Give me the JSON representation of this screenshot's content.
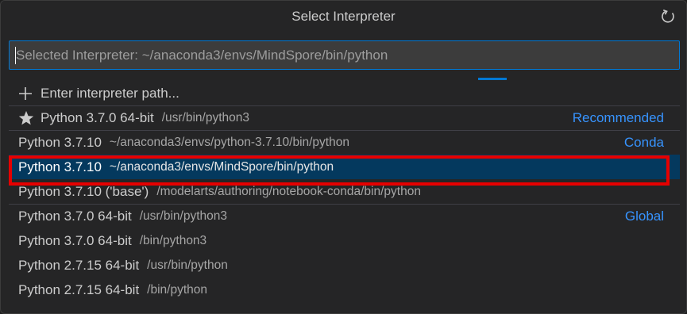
{
  "title": "Select Interpreter",
  "refresh_icon": "refresh-icon",
  "search": {
    "placeholder": "Selected Interpreter: ~/anaconda3/envs/MindSpore/bin/python"
  },
  "enter_path": {
    "icon": "plus-icon",
    "label": "Enter interpreter path..."
  },
  "items": [
    {
      "name": "Python 3.7.0 64-bit",
      "path": "/usr/bin/python3",
      "tag": "Recommended",
      "icon": "star-icon"
    },
    {
      "name": "Python 3.7.10",
      "path": "~/anaconda3/envs/python-3.7.10/bin/python",
      "tag": "Conda"
    },
    {
      "name": "Python 3.7.10",
      "path": "~/anaconda3/envs/MindSpore/bin/python",
      "tag": "",
      "selected": true
    },
    {
      "name": "Python 3.7.10 ('base')",
      "path": "/modelarts/authoring/notebook-conda/bin/python",
      "tag": ""
    },
    {
      "name": "Python 3.7.0 64-bit",
      "path": "/usr/bin/python3",
      "tag": "Global"
    },
    {
      "name": "Python 3.7.0 64-bit",
      "path": "/bin/python3",
      "tag": ""
    },
    {
      "name": "Python 2.7.15 64-bit",
      "path": "/usr/bin/python",
      "tag": ""
    },
    {
      "name": "Python 2.7.15 64-bit",
      "path": "/bin/python",
      "tag": ""
    }
  ],
  "colors": {
    "accent": "#0078d4",
    "tag": "#3794ff",
    "selected_bg": "#04395e",
    "highlight": "#e60000"
  }
}
